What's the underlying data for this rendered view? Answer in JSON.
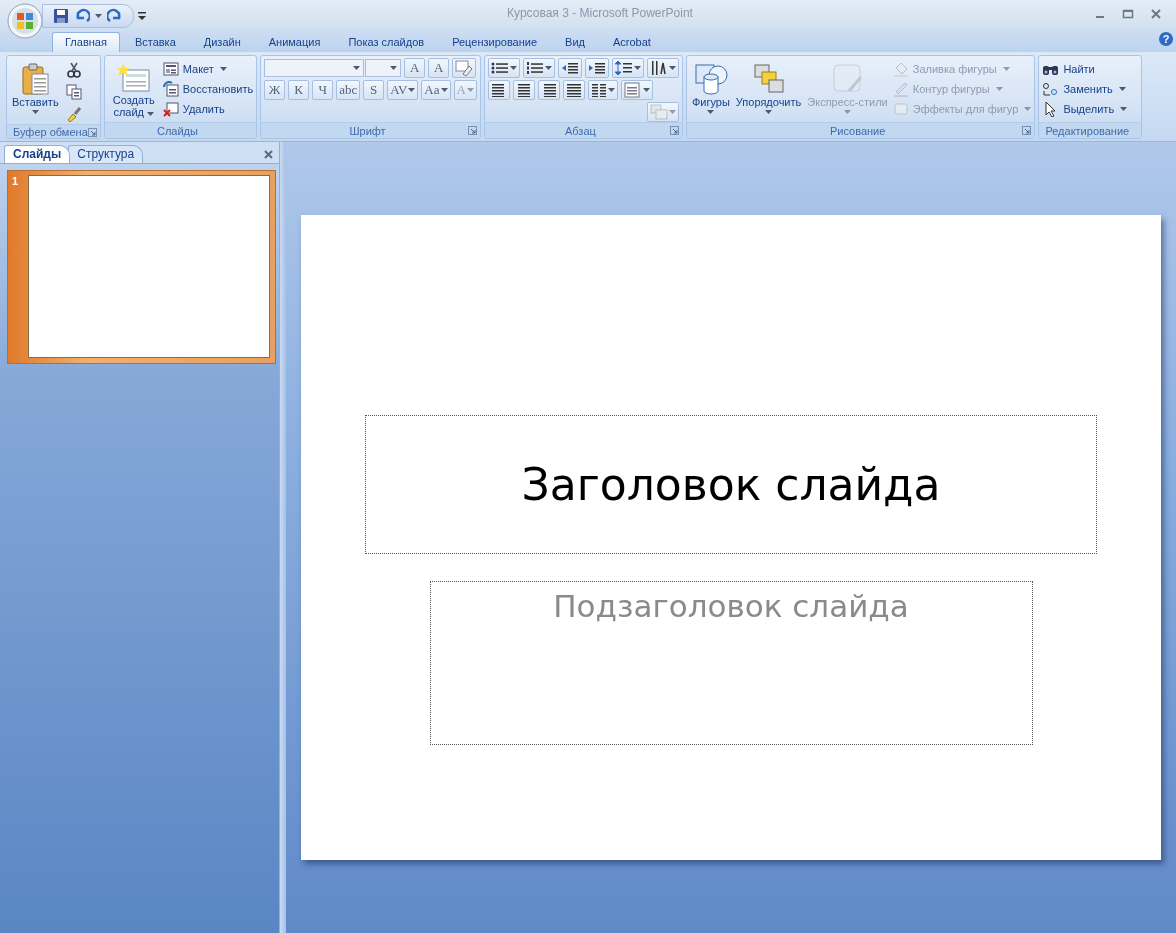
{
  "window": {
    "title": "Курсовая 3 - Microsoft PowerPoint"
  },
  "tabs": [
    {
      "label": "Главная",
      "selected": true
    },
    {
      "label": "Вставка",
      "selected": false
    },
    {
      "label": "Дизайн",
      "selected": false
    },
    {
      "label": "Анимация",
      "selected": false
    },
    {
      "label": "Показ слайдов",
      "selected": false
    },
    {
      "label": "Рецензирование",
      "selected": false
    },
    {
      "label": "Вид",
      "selected": false
    },
    {
      "label": "Acrobat",
      "selected": false
    }
  ],
  "help": "?",
  "ribbon": {
    "groups": [
      {
        "label": "Буфер обмена",
        "launcher": true,
        "kind": "columns",
        "lines": [
          [
            {
              "kind": "large",
              "label": "Вставить",
              "dropdown": true,
              "disabled": false
            }
          ],
          [
            {
              "kind": "icon",
              "dropdown": false,
              "disabled": false
            },
            {
              "kind": "icon",
              "dropdown": false,
              "disabled": false
            },
            {
              "kind": "icon",
              "dropdown": false,
              "disabled": false
            }
          ]
        ]
      },
      {
        "label": "Слайды",
        "launcher": false,
        "kind": "columns",
        "lines": [
          [
            {
              "kind": "large",
              "label": "Создать слайд",
              "dropdown": true,
              "disabled": false
            }
          ],
          [
            {
              "kind": "small",
              "label": "Макет",
              "dropdown": true,
              "disabled": false
            },
            {
              "kind": "small",
              "label": "Восстановить",
              "dropdown": false,
              "disabled": false
            },
            {
              "kind": "small",
              "label": "Удалить",
              "dropdown": false,
              "disabled": false
            }
          ]
        ]
      },
      {
        "label": "Шрифт",
        "launcher": true,
        "kind": "rows",
        "lines": [
          [
            {
              "kind": "combo"
            },
            {
              "kind": "combo"
            },
            {
              "kind": "glyph",
              "text": "A",
              "dropdown": false,
              "disabled": false
            },
            {
              "kind": "glyph",
              "text": "A",
              "dropdown": false,
              "disabled": false
            },
            {
              "kind": "icon",
              "dropdown": false,
              "disabled": false
            }
          ],
          [
            {
              "kind": "glyph",
              "text": "Ж",
              "dropdown": false,
              "disabled": false
            },
            {
              "kind": "glyph",
              "text": "К",
              "dropdown": false,
              "disabled": false
            },
            {
              "kind": "glyph",
              "text": "Ч",
              "dropdown": false,
              "disabled": false
            },
            {
              "kind": "glyph",
              "text": "abc",
              "dropdown": false,
              "disabled": false
            },
            {
              "kind": "glyph",
              "text": "S",
              "dropdown": false,
              "disabled": false
            },
            {
              "kind": "glyph",
              "text": "AV",
              "dropdown": true,
              "disabled": false
            },
            {
              "kind": "glyph",
              "text": "Aa",
              "dropdown": true,
              "disabled": false
            },
            {
              "kind": "glyph",
              "text": "A",
              "dropdown": true,
              "disabled": true
            }
          ]
        ]
      },
      {
        "label": "Абзац",
        "launcher": true,
        "kind": "rows",
        "lines": [
          [
            {
              "kind": "icon",
              "dropdown": true,
              "disabled": false
            },
            {
              "kind": "icon",
              "dropdown": true,
              "disabled": false
            },
            {
              "kind": "icon",
              "dropdown": false,
              "disabled": false
            },
            {
              "kind": "icon",
              "dropdown": false,
              "disabled": false
            },
            {
              "kind": "icon",
              "dropdown": true,
              "disabled": false
            },
            {
              "kind": "icon",
              "dropdown": true,
              "disabled": false
            }
          ],
          [
            {
              "kind": "icon",
              "dropdown": false,
              "disabled": false
            },
            {
              "kind": "icon",
              "dropdown": false,
              "disabled": false
            },
            {
              "kind": "icon",
              "dropdown": false,
              "disabled": false
            },
            {
              "kind": "icon",
              "dropdown": false,
              "disabled": false
            },
            {
              "kind": "icon",
              "dropdown": true,
              "disabled": false
            },
            {
              "kind": "icon",
              "dropdown": true,
              "disabled": false
            }
          ],
          [
            {
              "kind": "icon",
              "dropdown": true,
              "disabled": true
            }
          ]
        ]
      },
      {
        "label": "Рисование",
        "launcher": true,
        "kind": "columns",
        "lines": [
          [
            {
              "kind": "large",
              "label": "Фигуры",
              "dropdown": true,
              "disabled": false
            }
          ],
          [
            {
              "kind": "large",
              "label": "Упорядочить",
              "dropdown": true,
              "disabled": false
            }
          ],
          [
            {
              "kind": "large",
              "label": "Экспресс-стили",
              "dropdown": true,
              "disabled": true
            }
          ],
          [
            {
              "kind": "small",
              "label": "Заливка фигуры",
              "dropdown": true,
              "disabled": true
            },
            {
              "kind": "small",
              "label": "Контур фигуры",
              "dropdown": true,
              "disabled": true
            },
            {
              "kind": "small",
              "label": "Эффекты для фигур",
              "dropdown": true,
              "disabled": true
            }
          ]
        ]
      },
      {
        "label": "Редактирование",
        "launcher": false,
        "kind": "columns",
        "lines": [
          [
            {
              "kind": "small",
              "label": "Найти",
              "dropdown": false,
              "disabled": false
            },
            {
              "kind": "small",
              "label": "Заменить",
              "dropdown": true,
              "disabled": false
            },
            {
              "kind": "small",
              "label": "Выделить",
              "dropdown": true,
              "disabled": false
            }
          ]
        ]
      }
    ]
  },
  "pane": {
    "tabs": [
      {
        "label": "Слайды",
        "selected": true
      },
      {
        "label": "Структура",
        "selected": false
      }
    ],
    "thumbnails": [
      {
        "number": "1",
        "selected": true
      }
    ]
  },
  "slide": {
    "title": "Заголовок слайда",
    "subtitle": "Подзаголовок слайда"
  }
}
